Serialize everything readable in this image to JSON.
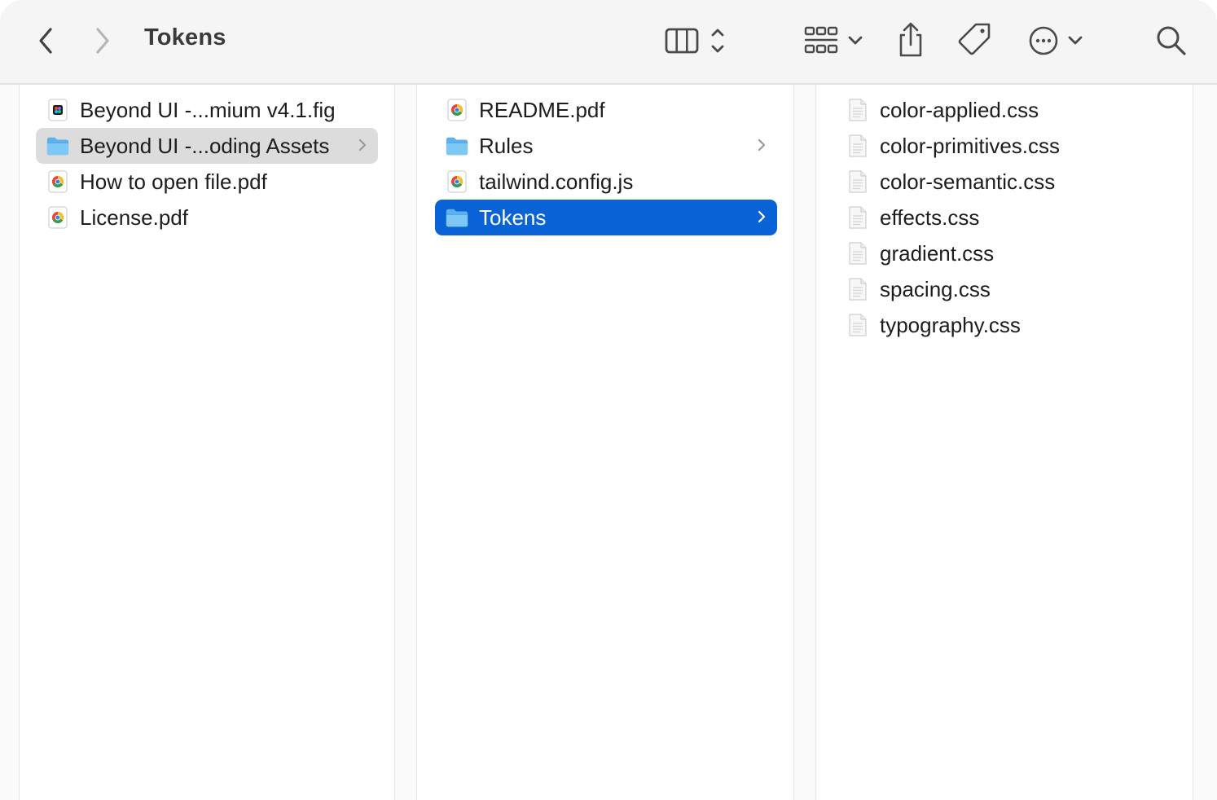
{
  "window": {
    "title": "Tokens"
  },
  "toolbar": {
    "back_icon": "chevron-left-icon",
    "forward_icon": "chevron-right-icon",
    "view_icon": "columns-view-icon",
    "group_icon": "grid-group-icon",
    "share_icon": "share-icon",
    "tag_icon": "tag-icon",
    "more_icon": "ellipsis-circle-icon",
    "search_icon": "search-icon"
  },
  "columns": [
    {
      "items": [
        {
          "label": "Beyond UI -...mium v4.1.fig",
          "icon": "figma-file-icon",
          "folder": false,
          "state": "none"
        },
        {
          "label": "Beyond UI -...oding Assets",
          "icon": "folder-icon",
          "folder": true,
          "state": "inactive-selected"
        },
        {
          "label": "How to open file.pdf",
          "icon": "pdf-file-icon",
          "folder": false,
          "state": "none"
        },
        {
          "label": "License.pdf",
          "icon": "pdf-file-icon",
          "folder": false,
          "state": "none"
        }
      ]
    },
    {
      "items": [
        {
          "label": "README.pdf",
          "icon": "pdf-file-icon",
          "folder": false,
          "state": "none"
        },
        {
          "label": "Rules",
          "icon": "folder-icon",
          "folder": true,
          "state": "none"
        },
        {
          "label": "tailwind.config.js",
          "icon": "pdf-file-icon",
          "folder": false,
          "state": "none"
        },
        {
          "label": "Tokens",
          "icon": "folder-icon",
          "folder": true,
          "state": "selected"
        }
      ]
    },
    {
      "items": [
        {
          "label": "color-applied.css",
          "icon": "document-icon",
          "folder": false,
          "state": "none"
        },
        {
          "label": "color-primitives.css",
          "icon": "document-icon",
          "folder": false,
          "state": "none"
        },
        {
          "label": "color-semantic.css",
          "icon": "document-icon",
          "folder": false,
          "state": "none"
        },
        {
          "label": "effects.css",
          "icon": "document-icon",
          "folder": false,
          "state": "none"
        },
        {
          "label": "gradient.css",
          "icon": "document-icon",
          "folder": false,
          "state": "none"
        },
        {
          "label": "spacing.css",
          "icon": "document-icon",
          "folder": false,
          "state": "none"
        },
        {
          "label": "typography.css",
          "icon": "document-icon",
          "folder": false,
          "state": "none"
        }
      ]
    }
  ],
  "colors": {
    "selection": "#0a63d6",
    "inactive_selection": "#dcdcdc",
    "folder": "#5cb2ec",
    "toolbar_bg": "#f6f5f6"
  }
}
